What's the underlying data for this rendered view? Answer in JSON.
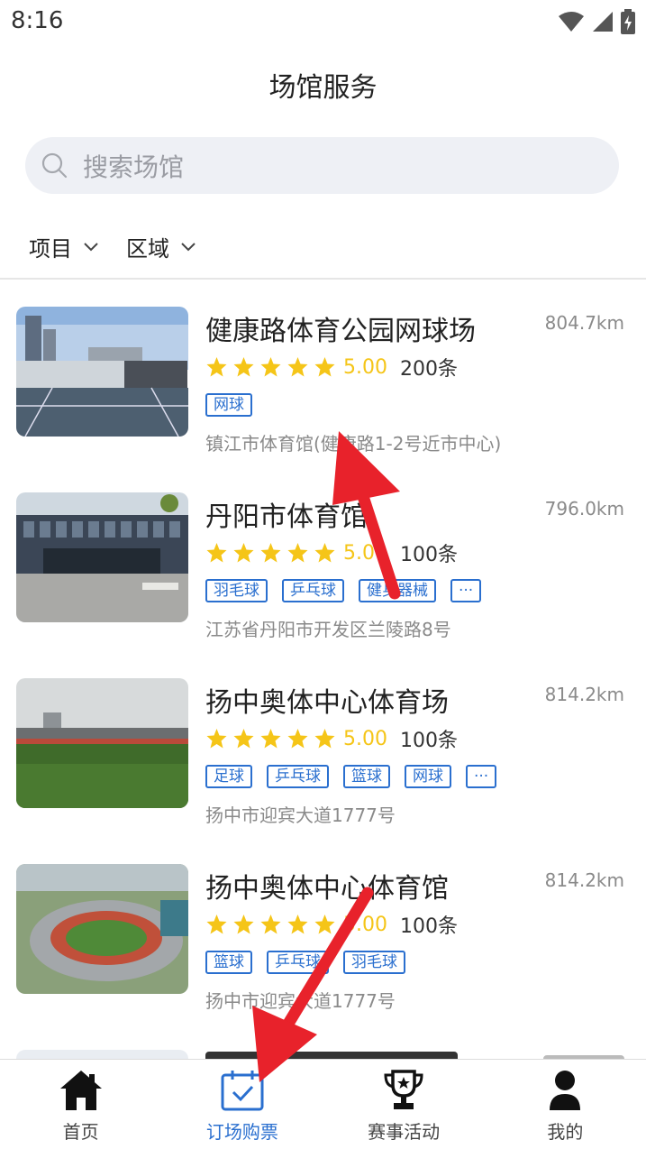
{
  "status_bar": {
    "time": "8:16"
  },
  "header": {
    "title": "场馆服务"
  },
  "search": {
    "placeholder": "搜索场馆"
  },
  "filters": [
    {
      "label": "项目"
    },
    {
      "label": "区域"
    }
  ],
  "venues": [
    {
      "name": "健康路体育公园网球场",
      "distance": "804.7km",
      "rating": "5.00",
      "stars": 5,
      "reviews": "200条",
      "tags": [
        "网球"
      ],
      "address": "镇江市体育馆(健康路1-2号近市中心)",
      "photo": "tennis-court-photo"
    },
    {
      "name": "丹阳市体育馆",
      "distance": "796.0km",
      "rating": "5.00",
      "stars": 5,
      "reviews": "100条",
      "tags": [
        "羽毛球",
        "乒乓球",
        "健身器械",
        "···"
      ],
      "address": "江苏省丹阳市开发区兰陵路8号",
      "photo": "gymnasium-building-photo"
    },
    {
      "name": "扬中奥体中心体育场",
      "distance": "814.2km",
      "rating": "5.00",
      "stars": 5,
      "reviews": "100条",
      "tags": [
        "足球",
        "乒乓球",
        "篮球",
        "网球",
        "···"
      ],
      "address": "扬中市迎宾大道1777号",
      "photo": "stadium-field-photo"
    },
    {
      "name": "扬中奥体中心体育馆",
      "distance": "814.2km",
      "rating": "5.00",
      "stars": 5,
      "reviews": "100条",
      "tags": [
        "篮球",
        "乒乓球",
        "羽毛球"
      ],
      "address": "扬中市迎宾大道1777号",
      "photo": "aerial-stadium-photo"
    }
  ],
  "tab_bar": [
    {
      "label": "首页",
      "icon": "home-icon",
      "active": false
    },
    {
      "label": "订场购票",
      "icon": "calendar-check-icon",
      "active": true
    },
    {
      "label": "赛事活动",
      "icon": "trophy-icon",
      "active": false
    },
    {
      "label": "我的",
      "icon": "user-icon",
      "active": false
    }
  ],
  "colors": {
    "accent": "#2a6fcf",
    "star": "#f5c518",
    "annotation_arrow": "#e8222b"
  }
}
